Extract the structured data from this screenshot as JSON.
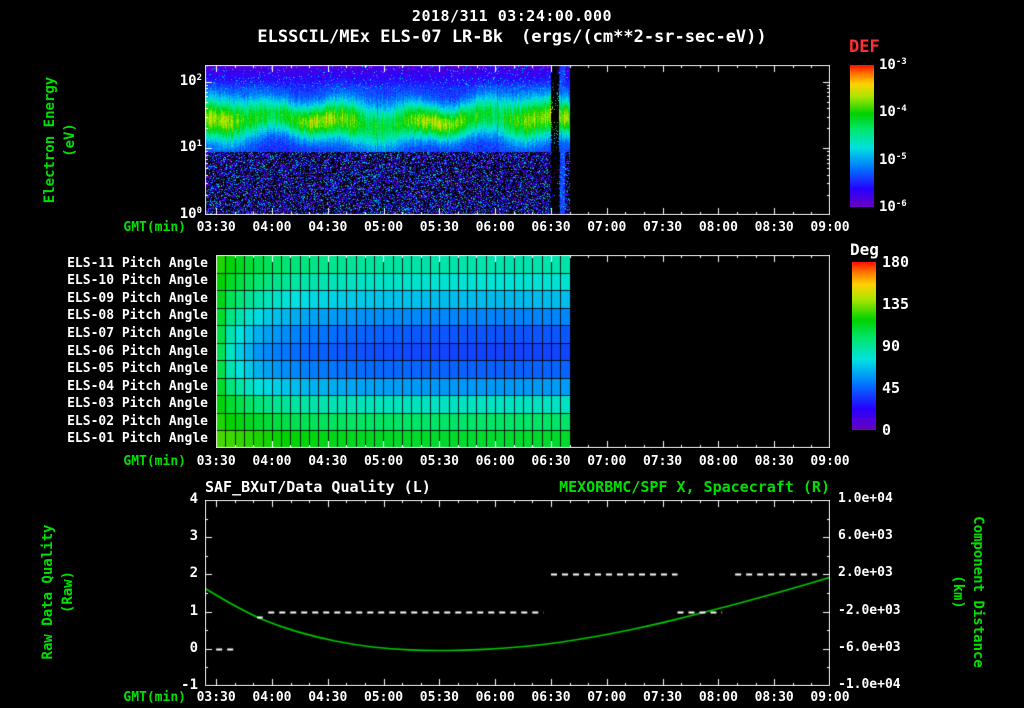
{
  "header": {
    "datetime": "2018/311 03:24:00.000",
    "instrument": "ELSSCIL/MEx ELS-07 LR-Bk",
    "units": "(ergs/(cm**2-sr-sec-eV))"
  },
  "colors": {
    "background": "#000000",
    "text": "#ffffff",
    "axis_label_green": "#00e000",
    "def_title_red": "#ff3030",
    "distance_curve": "#00c800",
    "quality_dashes": "#ffffff"
  },
  "time_axis": {
    "label": "GMT(min)",
    "start": "03:24",
    "end": "09:00",
    "tick_labels": [
      "03:30",
      "04:00",
      "04:30",
      "05:00",
      "05:30",
      "06:00",
      "06:30",
      "07:00",
      "07:30",
      "08:00",
      "08:30",
      "09:00"
    ]
  },
  "spectrogram": {
    "ylabel_line1": "Electron Energy",
    "ylabel_line2": "(eV)",
    "ytick_labels": [
      "10^2",
      "10^1",
      "10^0"
    ],
    "colorbar_title": "DEF",
    "colorbar_tick_labels": [
      "10^-3",
      "10^-4",
      "10^-5",
      "10^-6"
    ]
  },
  "pitch": {
    "row_labels": [
      "ELS-11 Pitch Angle",
      "ELS-10 Pitch Angle",
      "ELS-09 Pitch Angle",
      "ELS-08 Pitch Angle",
      "ELS-07 Pitch Angle",
      "ELS-06 Pitch Angle",
      "ELS-05 Pitch Angle",
      "ELS-04 Pitch Angle",
      "ELS-03 Pitch Angle",
      "ELS-02 Pitch Angle",
      "ELS-01 Pitch Angle"
    ],
    "colorbar_title": "Deg",
    "colorbar_tick_labels": [
      "180",
      "135",
      "90",
      "45",
      "0"
    ]
  },
  "bottom": {
    "title_left": "SAF_BXuT/Data Quality (L)",
    "title_right": "MEXORBMC/SPF X, Spacecraft (R)",
    "ylabel_left_line1": "Raw Data Quality",
    "ylabel_left_line2": "(Raw)",
    "ylabel_right_line1": "Component Distance",
    "ylabel_right_line2": "(km)",
    "left_tick_labels": [
      "4",
      "3",
      "2",
      "1",
      "0",
      "-1"
    ],
    "right_tick_labels": [
      "1.0e+04",
      "6.0e+03",
      "2.0e+03",
      "-2.0e+03",
      "-6.0e+03",
      "-1.0e+04"
    ]
  },
  "chart_data": [
    {
      "type": "heatmap",
      "name": "electron-energy-spectrogram",
      "title": "ELSSCIL/MEx ELS-07 LR-Bk",
      "units": "ergs/(cm**2-sr-sec-eV)",
      "x": {
        "label": "GMT(min)",
        "start_label": "03:24",
        "end_label": "09:00",
        "start_min": 0,
        "end_min": 336
      },
      "y": {
        "label": "Electron Energy (eV)",
        "scale": "log",
        "min": 1,
        "max": 178
      },
      "z": {
        "label": "DEF",
        "scale": "log",
        "min": 1e-06,
        "max": 0.001
      },
      "data_end_min": 196,
      "dropout_min": [
        186,
        190
      ],
      "band": {
        "center_eV": 26,
        "log_width": 0.2,
        "peak_flux": 0.0001,
        "background_flux": 3.5e-06
      }
    },
    {
      "type": "heatmap",
      "name": "pitch-angle-panels",
      "units": "deg",
      "rows": [
        "ELS-11",
        "ELS-10",
        "ELS-09",
        "ELS-08",
        "ELS-07",
        "ELS-06",
        "ELS-05",
        "ELS-04",
        "ELS-03",
        "ELS-02",
        "ELS-01"
      ],
      "x": {
        "label": "GMT(min)",
        "start_min": 6,
        "end_min": 336,
        "data_end_min": 196
      },
      "colorbar": {
        "title": "Deg",
        "min": 0,
        "max": 180
      },
      "sample_min": [
        6,
        15,
        30,
        50,
        80,
        120,
        160,
        196
      ],
      "angles_deg": [
        [
          125,
          116,
          104,
          96,
          90,
          87,
          86,
          87
        ],
        [
          122,
          110,
          97,
          88,
          82,
          79,
          78,
          79
        ],
        [
          120,
          100,
          85,
          75,
          70,
          67,
          66,
          67
        ],
        [
          118,
          90,
          72,
          62,
          57,
          54,
          53,
          54
        ],
        [
          116,
          80,
          62,
          52,
          46,
          43,
          42,
          43
        ],
        [
          115,
          75,
          56,
          47,
          42,
          39,
          38,
          39
        ],
        [
          116,
          80,
          62,
          53,
          48,
          46,
          45,
          46
        ],
        [
          118,
          92,
          75,
          66,
          61,
          58,
          58,
          59
        ],
        [
          121,
          108,
          95,
          88,
          84,
          82,
          82,
          82
        ],
        [
          124,
          118,
          110,
          104,
          101,
          100,
          100,
          100
        ],
        [
          128,
          126,
          122,
          117,
          113,
          111,
          110,
          111
        ]
      ]
    },
    {
      "type": "line",
      "name": "quality-and-distance",
      "x": {
        "label": "GMT(min)",
        "start_min": 0,
        "end_min": 336
      },
      "left_axis": {
        "label": "Raw Data Quality (Raw)",
        "min": -1,
        "max": 4,
        "ticks": [
          4,
          3,
          2,
          1,
          0,
          -1
        ]
      },
      "right_axis": {
        "label": "Component Distance (km)",
        "min": -10000,
        "max": 10000,
        "ticks": [
          10000,
          6000,
          2000,
          -2000,
          -6000,
          -10000
        ]
      },
      "series": [
        {
          "name": "MEXORBMC/SPF X, Spacecraft (R)",
          "axis": "right",
          "style": "solid",
          "color": "#00c800",
          "t_min": [
            0,
            20,
            40,
            60,
            80,
            100,
            120,
            140,
            160,
            180,
            200,
            220,
            240,
            260,
            280,
            300,
            320,
            336
          ],
          "km": [
            480,
            -1920,
            -3600,
            -4760,
            -5560,
            -6040,
            -6200,
            -6160,
            -5960,
            -5600,
            -5040,
            -4320,
            -3480,
            -2520,
            -1480,
            -400,
            720,
            1680
          ]
        },
        {
          "name": "SAF_BXuT/Data Quality (L)",
          "axis": "left",
          "style": "dashed",
          "color": "#ffffff",
          "segments": [
            {
              "value": 0,
              "start_min": 6,
              "end_min": 16
            },
            {
              "value": 0.85,
              "start_min": 28,
              "end_min": 31
            },
            {
              "value": 1,
              "start_min": 34,
              "end_min": 182
            },
            {
              "value": 2,
              "start_min": 186,
              "end_min": 254
            },
            {
              "value": 1,
              "start_min": 254,
              "end_min": 278
            },
            {
              "value": 2,
              "start_min": 285,
              "end_min": 329
            }
          ]
        }
      ]
    }
  ]
}
